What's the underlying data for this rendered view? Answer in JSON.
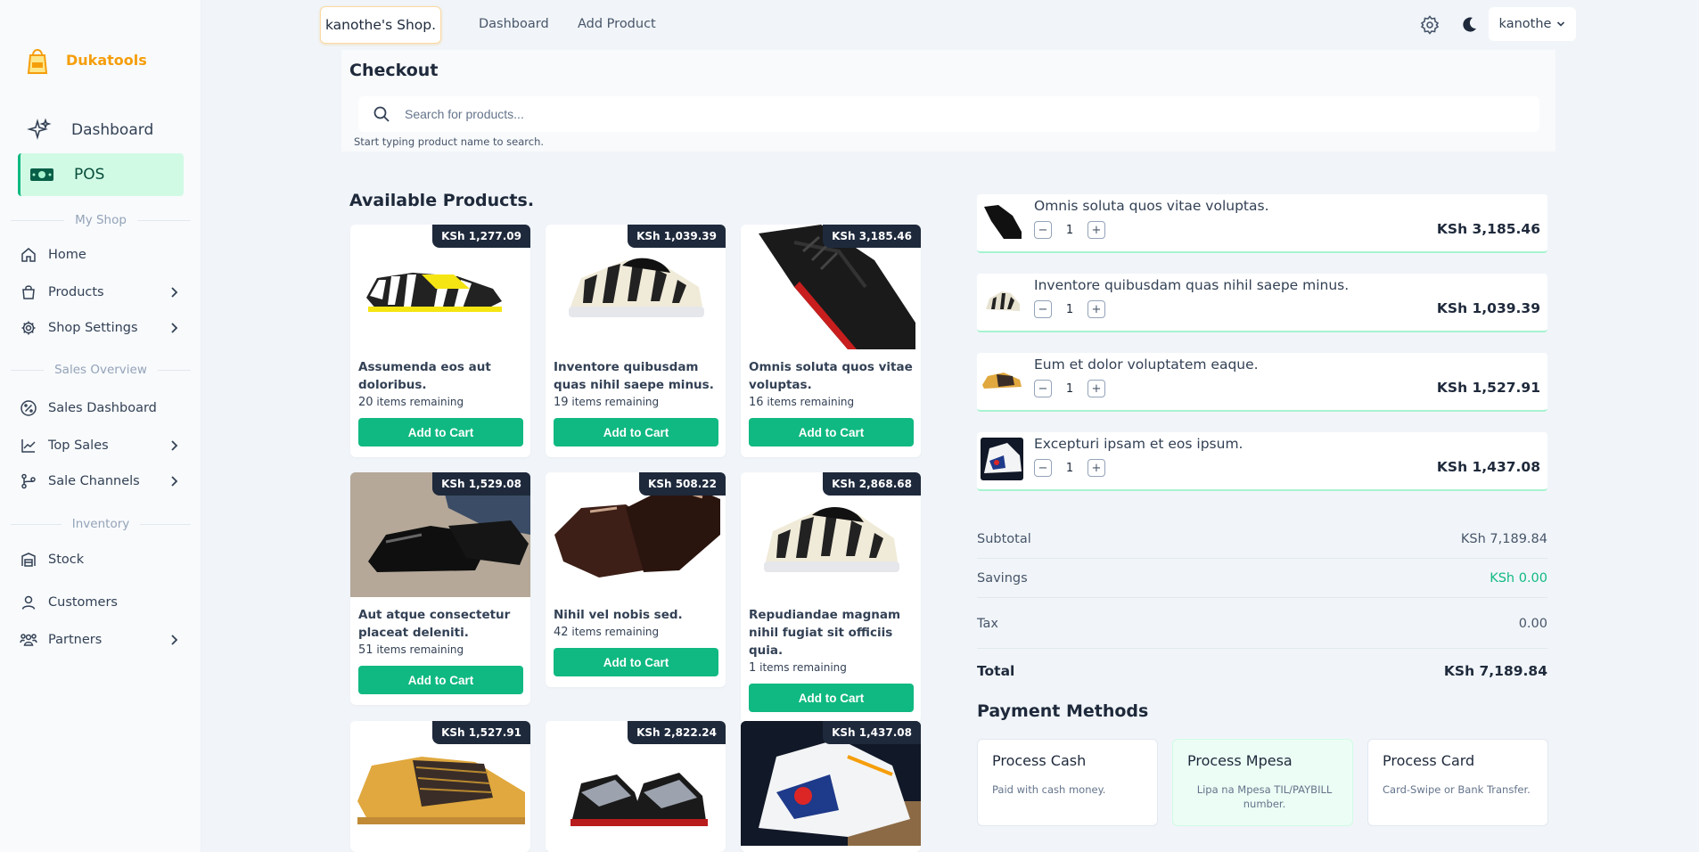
{
  "brand": {
    "name": "Dukatools"
  },
  "sidebar": {
    "dashboard": "Dashboard",
    "pos": "POS",
    "sections": {
      "my_shop": "My Shop",
      "sales_overview": "Sales Overview",
      "inventory": "Inventory"
    },
    "items": {
      "home": "Home",
      "products": "Products",
      "shop_settings": "Shop Settings",
      "sales_dashboard": "Sales Dashboard",
      "top_sales": "Top Sales",
      "sale_channels": "Sale Channels",
      "stock": "Stock",
      "customers": "Customers",
      "partners": "Partners"
    }
  },
  "topbar": {
    "shop": "kanothe's Shop.",
    "dashboard": "Dashboard",
    "add_product": "Add Product",
    "user": "kanothe"
  },
  "checkout": {
    "title": "Checkout",
    "search_placeholder": "Search for products...",
    "search_hint": "Start typing product name to search."
  },
  "products": {
    "title": "Available Products.",
    "items_remaining_label": "items remaining",
    "add_label": "Add to Cart",
    "list": [
      {
        "price": "KSh 1,277.09",
        "name": "Assumenda eos aut doloribus.",
        "remaining": "20"
      },
      {
        "price": "KSh 1,039.39",
        "name": "Inventore quibusdam quas nihil saepe minus.",
        "remaining": "19"
      },
      {
        "price": "KSh 3,185.46",
        "name": "Omnis soluta quos vitae voluptas.",
        "remaining": "16"
      },
      {
        "price": "KSh 1,529.08",
        "name": "Aut atque consectetur placeat deleniti.",
        "remaining": "51"
      },
      {
        "price": "KSh 508.22",
        "name": "Nihil vel nobis sed.",
        "remaining": "42"
      },
      {
        "price": "KSh 2,868.68",
        "name": "Repudiandae magnam nihil fugiat sit officiis quia.",
        "remaining": "1"
      },
      {
        "price": "KSh 1,527.91"
      },
      {
        "price": "KSh 2,822.24"
      },
      {
        "price": "KSh 1,437.08"
      }
    ]
  },
  "cart": {
    "items": [
      {
        "name": "Omnis soluta quos vitae voluptas.",
        "qty": "1",
        "price": "KSh 3,185.46"
      },
      {
        "name": "Inventore quibusdam quas nihil saepe minus.",
        "qty": "1",
        "price": "KSh 1,039.39"
      },
      {
        "name": "Eum et dolor voluptatem eaque.",
        "qty": "1",
        "price": "KSh 1,527.91"
      },
      {
        "name": "Excepturi ipsam et eos ipsum.",
        "qty": "1",
        "price": "KSh 1,437.08"
      }
    ],
    "subtotal_label": "Subtotal",
    "subtotal": "KSh 7,189.84",
    "savings_label": "Savings",
    "savings": "KSh 0.00",
    "tax_label": "Tax",
    "tax": "0.00",
    "total_label": "Total",
    "total": "KSh 7,189.84"
  },
  "payment": {
    "title": "Payment Methods",
    "cash": {
      "title": "Process Cash",
      "desc": "Paid with cash money."
    },
    "mpesa": {
      "title": "Process Mpesa",
      "desc": "Lipa na Mpesa TIL/PAYBILL number."
    },
    "card": {
      "title": "Process Card",
      "desc": "Card-Swipe or Bank Transfer."
    }
  }
}
